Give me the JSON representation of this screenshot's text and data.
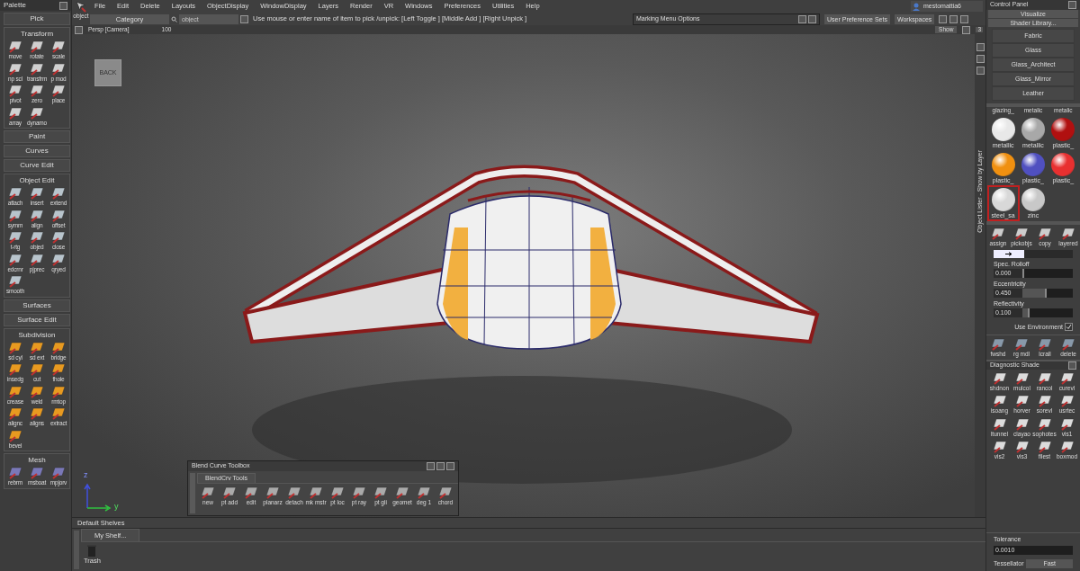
{
  "palette": {
    "title": "Palette",
    "sections": [
      {
        "title": "Pick"
      },
      {
        "title": "Transform",
        "color": "#d0d0d0",
        "tools": [
          "move",
          "rotate",
          "scale",
          "np scl",
          "transfrm",
          "p mod",
          "pivot",
          "zero",
          "place",
          "array",
          "dynamo"
        ]
      },
      {
        "title": "Paint"
      },
      {
        "title": "Curves"
      },
      {
        "title": "Curve Edit"
      },
      {
        "title": "Object Edit",
        "color": "#b8c4cc",
        "tools": [
          "attach",
          "insert",
          "extend",
          "symm",
          "align",
          "offset",
          "t-rtg",
          "objed",
          "close",
          "edcrnr",
          "pjprec",
          "qryed",
          "smooth"
        ]
      },
      {
        "title": "Surfaces"
      },
      {
        "title": "Surface Edit"
      },
      {
        "title": "Subdivision",
        "color": "#e89a20",
        "tools": [
          "sd cyl",
          "sd ext",
          "bridge",
          "insedg",
          "cut",
          "fhole",
          "crease",
          "weld",
          "rmtop",
          "alignc",
          "aligns",
          "extract",
          "bevel"
        ]
      },
      {
        "title": "Mesh",
        "color": "#7a78b8",
        "tools": [
          "rebrm",
          "msboat",
          "mpjorv"
        ]
      }
    ]
  },
  "menu_bar": {
    "object_label": "object",
    "items": [
      "File",
      "Edit",
      "Delete",
      "Layouts",
      "ObjectDisplay",
      "WindowDisplay",
      "Layers",
      "Render",
      "VR",
      "Windows",
      "Preferences",
      "Utilities",
      "Help"
    ],
    "user": "mestomattia6"
  },
  "pick_bar": {
    "category": "Category",
    "object_placeholder": "object",
    "prompt": "Use mouse or enter name of item to pick /unpick: [Left Toggle ] [Middle Add ] [Right Unpick ]"
  },
  "marking_menu": {
    "title": "Marking Menu Options"
  },
  "buttons": [
    "User Preference Sets",
    "Workspaces"
  ],
  "viewport": {
    "camera": "Persp [Camera]",
    "zoom": "100",
    "show": "Show",
    "layout_number": "3",
    "back_label": "BACK",
    "axes": [
      "z",
      "y"
    ],
    "side_label": "Object Lister - Show by Layer"
  },
  "blend_toolbox": {
    "title": "Blend Curve Toolbox",
    "tab": "BlendCrv Tools",
    "tools": [
      "new",
      "pt add",
      "edit",
      "planarz",
      "detach",
      "mk mstr",
      "pt loc",
      "pt ray",
      "pt gli",
      "geomet",
      "deg 1",
      "chord"
    ]
  },
  "shelves": {
    "title": "Default Shelves",
    "tabs": [
      {
        "label": "My Shelf...",
        "selected": true
      }
    ],
    "items": [
      "Trash"
    ]
  },
  "control_panel": {
    "title": "Control Panel",
    "mode": "Visualize",
    "library": "Shader Library...",
    "categories": [
      "Fabric",
      "Glass",
      "Glass_Architect",
      "Glass_Mirror",
      "Leather"
    ],
    "cut_labels": [
      "glazing_",
      "metalic",
      "metalic"
    ],
    "shaders": [
      {
        "name": "metallic",
        "color": "#e8e8e8",
        "selected": false
      },
      {
        "name": "metallic",
        "color": "#a8a8a8",
        "selected": false
      },
      {
        "name": "plastic_",
        "color": "#b01010",
        "selected": false
      },
      {
        "name": "plastic_",
        "color": "#f09010",
        "selected": false
      },
      {
        "name": "plastic_",
        "color": "#5050c0",
        "selected": false
      },
      {
        "name": "plastic_",
        "color": "#e83030",
        "selected": false
      },
      {
        "name": "steel_sa",
        "color": "#d8d8d8",
        "selected": true
      },
      {
        "name": "zinc",
        "color": "#c8c8c8",
        "selected": false
      }
    ],
    "shader_tools": [
      "assign",
      "pickobjs",
      "copy",
      "layered"
    ],
    "parameters": [
      {
        "label": "Spec. Rolloff",
        "value": "0.000",
        "level": 0
      },
      {
        "label": "Eccentricity",
        "value": "0.450",
        "level": 0.45
      },
      {
        "label": "Reflectivity",
        "value": "0.100",
        "level": 0.1
      }
    ],
    "use_environment": {
      "label": "Use Environment",
      "checked": true
    },
    "render_tools": [
      "fwshd",
      "rg mdl",
      "lcrall",
      "delete"
    ],
    "diagnostic": {
      "title": "Diagnostic Shade",
      "tools": [
        "shdnon",
        "mulcol",
        "rancol",
        "curevl",
        "isoang",
        "horver",
        "sorevl",
        "usrtec",
        "ltunnel",
        "clayao",
        "sophotes",
        "vis1",
        "vis2",
        "vis3",
        "filest",
        "boxmod"
      ]
    },
    "tolerance": {
      "label": "Tolerance",
      "value": "0.0010"
    },
    "tessellator": {
      "label": "Tessellator",
      "value": "Fast"
    }
  }
}
